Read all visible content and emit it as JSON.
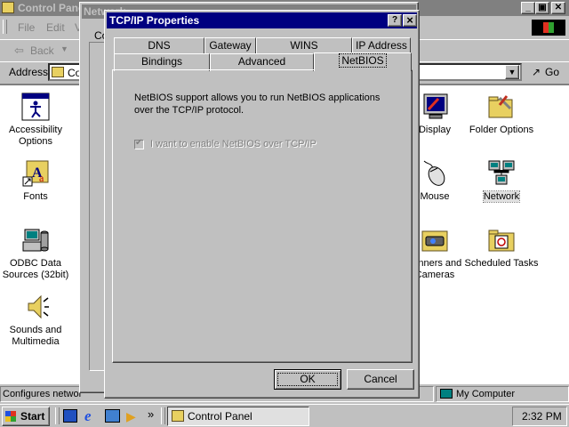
{
  "control_panel": {
    "title": "Control Panel",
    "menu": [
      "File",
      "Edit",
      "V"
    ],
    "back_label": "Back",
    "address_label": "Address",
    "address_value": "Co",
    "go_label": "Go",
    "status_left": "Configures networ",
    "status_right": "My Computer",
    "icons_left": [
      {
        "label": "Accessibility Options",
        "icon": "accessibility-icon"
      },
      {
        "label": "Fonts",
        "icon": "fonts-icon"
      },
      {
        "label": "ODBC Data Sources (32bit)",
        "icon": "odbc-icon"
      },
      {
        "label": "Sounds and Multimedia",
        "icon": "speaker-icon"
      }
    ],
    "icons_right_a": [
      {
        "label": "Display",
        "icon": "display-icon"
      },
      {
        "label": "Mouse",
        "icon": "mouse-icon"
      },
      {
        "label": "canners and Cameras",
        "icon": "scanner-icon"
      }
    ],
    "icons_right_b": [
      {
        "label": "Folder Options",
        "icon": "folder-options-icon"
      },
      {
        "label": "Network",
        "icon": "network-icon"
      },
      {
        "label": "Scheduled Tasks",
        "icon": "scheduled-tasks-icon"
      }
    ]
  },
  "network_window": {
    "title": "Network",
    "tab_fragment": "Co"
  },
  "dialog": {
    "title": "TCP/IP Properties",
    "help_btn": "?",
    "close_btn": "×",
    "tabs_back": [
      "DNS Configuration",
      "Gateway",
      "WINS Configuration",
      "IP Address"
    ],
    "tabs_front": [
      "Bindings",
      "Advanced",
      "NetBIOS"
    ],
    "active_tab": "NetBIOS",
    "description": "NetBIOS support allows you to run NetBIOS applications over the TCP/IP protocol.",
    "checkbox_label": "I want to enable NetBIOS over TCP/IP",
    "checkbox_checked": true,
    "checkbox_disabled": true,
    "ok_label": "OK",
    "cancel_label": "Cancel"
  },
  "taskbar": {
    "start_label": "Start",
    "task_label": "Control Panel",
    "clock": "2:32 PM",
    "chevron": "»"
  }
}
